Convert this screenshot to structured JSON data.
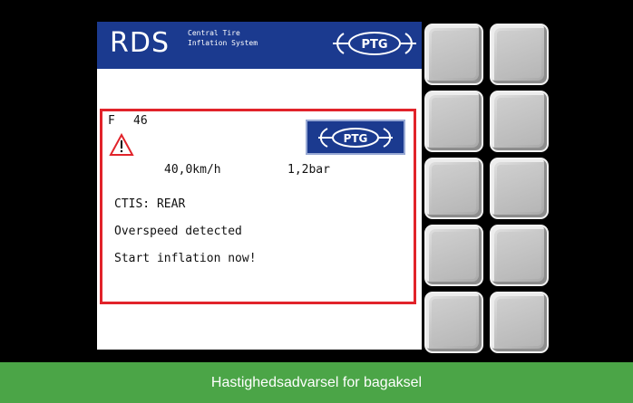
{
  "header": {
    "title": "RDS",
    "subtitle_line1": "Central Tire",
    "subtitle_line2": "Inflation System",
    "logo_text": "PTG"
  },
  "alarm": {
    "code_label": "F",
    "code_value": "46",
    "badge_logo_text": "PTG",
    "speed": "40,0km/h",
    "pressure": "1,2bar",
    "lines": [
      "CTIS: REAR",
      "Overspeed detected",
      "Start inflation now!"
    ]
  },
  "softkeys": {
    "rows": 5,
    "columns": 2
  },
  "caption": "Hastighedsadvarsel for bagaksel",
  "colors": {
    "header_blue": "#1b3a8f",
    "alarm_red": "#e1232a",
    "caption_green": "#4ba547"
  }
}
